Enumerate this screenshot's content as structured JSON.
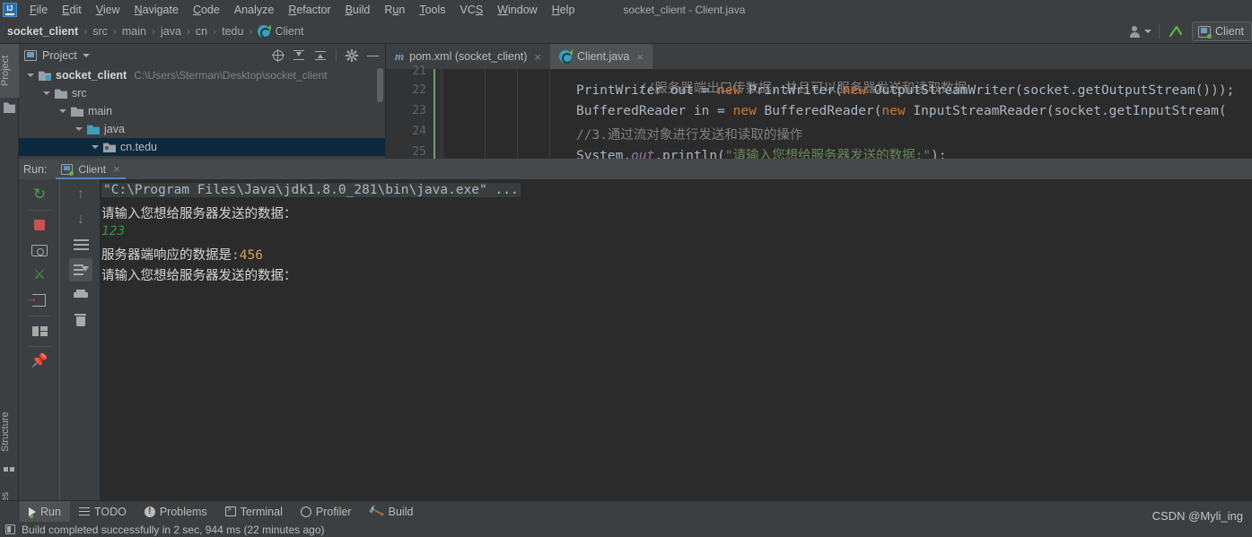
{
  "window": {
    "title": "socket_client - Client.java"
  },
  "menubar": {
    "logo": "intellij-idea-logo",
    "items": [
      {
        "label": "File",
        "mnemonic": "F"
      },
      {
        "label": "Edit",
        "mnemonic": "E"
      },
      {
        "label": "View",
        "mnemonic": "V"
      },
      {
        "label": "Navigate",
        "mnemonic": "N"
      },
      {
        "label": "Code",
        "mnemonic": "C"
      },
      {
        "label": "Analyze",
        "mnemonic": ""
      },
      {
        "label": "Refactor",
        "mnemonic": "R"
      },
      {
        "label": "Build",
        "mnemonic": "B"
      },
      {
        "label": "Run",
        "mnemonic": "R"
      },
      {
        "label": "Tools",
        "mnemonic": "T"
      },
      {
        "label": "VCS",
        "mnemonic": "S"
      },
      {
        "label": "Window",
        "mnemonic": "W"
      },
      {
        "label": "Help",
        "mnemonic": "H"
      }
    ]
  },
  "navbar": {
    "breadcrumbs": [
      "socket_client",
      "src",
      "main",
      "java",
      "cn",
      "tedu",
      "Client"
    ],
    "separator": "›",
    "right": {
      "account_icon": "user-avatar-icon",
      "caret_icon": "chevron-down-icon",
      "vcs_update_icon": "vcs-update-arrow-icon",
      "run_config_name": "Client",
      "run_config_icon": "run-configuration-icon"
    }
  },
  "left_strip": {
    "tabs": [
      {
        "label": "Project",
        "icon": "folder-icon",
        "active": true
      },
      {
        "label": "Structure",
        "icon": "structure-icon",
        "active": false
      },
      {
        "label": "Favorites",
        "icon": "star-icon",
        "active": false
      }
    ],
    "bottom_icon": "layout-icon"
  },
  "project": {
    "title": "Project",
    "title_icon": "project-icon",
    "dropdown_icon": "chevron-down-icon",
    "toolbar": [
      {
        "name": "locate-icon",
        "title": "Select Opened File"
      },
      {
        "name": "expand-all-icon",
        "title": "Expand All"
      },
      {
        "name": "collapse-all-icon",
        "title": "Collapse All"
      },
      {
        "name": "gear-icon",
        "title": "Settings"
      },
      {
        "name": "minimize-icon",
        "title": "Hide"
      }
    ],
    "tree": [
      {
        "label": "socket_client",
        "path": "C:\\Users\\Sterman\\Desktop\\socket_client",
        "depth": 0,
        "icon": "module-icon",
        "bold": true,
        "selected": false
      },
      {
        "label": "src",
        "path": "",
        "depth": 1,
        "icon": "folder-grey-icon",
        "bold": false,
        "selected": false
      },
      {
        "label": "main",
        "path": "",
        "depth": 2,
        "icon": "folder-grey-icon",
        "bold": false,
        "selected": false
      },
      {
        "label": "java",
        "path": "",
        "depth": 3,
        "icon": "folder-blue-icon",
        "bold": false,
        "selected": false
      },
      {
        "label": "cn.tedu",
        "path": "",
        "depth": 4,
        "icon": "package-icon",
        "bold": false,
        "selected": true
      }
    ]
  },
  "editor": {
    "tabs": [
      {
        "label": "pom.xml (socket_client)",
        "icon": "maven-icon",
        "active": false,
        "close": "×"
      },
      {
        "label": "Client.java",
        "icon": "java-class-icon",
        "active": true,
        "close": "×"
      }
    ],
    "line_numbers": [
      "21",
      "22",
      "23",
      "24",
      "25"
    ],
    "lines": [
      {
        "num": "21",
        "tokens": [
          {
            "t": "//服务器端出口传数据，并且可以服务器发送和读取数据",
            "c": "cmt"
          }
        ]
      },
      {
        "num": "22",
        "tokens": [
          {
            "t": "PrintWriter out = ",
            "c": "pln"
          },
          {
            "t": "new",
            "c": "kw"
          },
          {
            "t": " PrintWriter(",
            "c": "pln"
          },
          {
            "t": "new",
            "c": "kw"
          },
          {
            "t": " OutputStreamWriter(socket.getOutputStream()))",
            "c": "pln"
          },
          {
            "t": ";",
            "c": "pln"
          }
        ]
      },
      {
        "num": "23",
        "tokens": [
          {
            "t": "BufferedReader in = ",
            "c": "pln"
          },
          {
            "t": "new",
            "c": "kw"
          },
          {
            "t": " BufferedReader(",
            "c": "pln"
          },
          {
            "t": "new",
            "c": "kw"
          },
          {
            "t": " InputStreamReader(socket.getInputStream(",
            "c": "pln"
          }
        ]
      },
      {
        "num": "24",
        "tokens": [
          {
            "t": "//3.通过流对象进行发送和读取的操作",
            "c": "cmt"
          }
        ]
      },
      {
        "num": "25",
        "tokens": [
          {
            "t": "System.",
            "c": "pln"
          },
          {
            "t": "out",
            "c": "fld"
          },
          {
            "t": ".println(",
            "c": "pln"
          },
          {
            "t": "\"请输入您想给服务器发送的数据:\"",
            "c": "str"
          },
          {
            "t": ");",
            "c": "pln"
          }
        ]
      }
    ]
  },
  "run_window": {
    "label": "Run:",
    "tab": {
      "label": "Client",
      "icon": "run-configuration-icon",
      "close": "×"
    },
    "sidebar_left": [
      {
        "name": "rerun-icon",
        "title": "Rerun"
      },
      {
        "name": "stop-icon",
        "title": "Stop"
      },
      {
        "name": "camera-icon",
        "title": "Dump Threads"
      },
      {
        "name": "thread-dump-icon",
        "title": "Thread Dump"
      },
      {
        "name": "exit-icon",
        "title": "Exit"
      },
      {
        "name": "layout-icon",
        "title": "Layout Settings"
      },
      {
        "name": "pin-icon",
        "title": "Pin Tab"
      }
    ],
    "sidebar_right": [
      {
        "name": "arrow-up-icon",
        "title": "Up the Stack Trace"
      },
      {
        "name": "arrow-down-icon",
        "title": "Down the Stack Trace"
      },
      {
        "name": "soft-wrap-icon",
        "title": "Soft-Wrap"
      },
      {
        "name": "scroll-to-end-icon",
        "title": "Scroll to End",
        "active": true
      },
      {
        "name": "print-icon",
        "title": "Print"
      },
      {
        "name": "trash-icon",
        "title": "Clear All"
      }
    ],
    "console": [
      {
        "type": "command",
        "text": "\"C:\\Program Files\\Java\\jdk1.8.0_281\\bin\\java.exe\" ..."
      },
      {
        "type": "out",
        "text": "请输入您想给服务器发送的数据："
      },
      {
        "type": "input",
        "text": "123"
      },
      {
        "type": "out_mixed",
        "text": "服务器端响应的数据是",
        "suffix": ":456"
      },
      {
        "type": "out",
        "text": "请输入您想给服务器发送的数据："
      }
    ]
  },
  "bottom_tabs": [
    {
      "label": "Run",
      "icon": "run-triangle-icon",
      "active": true
    },
    {
      "label": "TODO",
      "icon": "list-icon",
      "active": false
    },
    {
      "label": "Problems",
      "icon": "info-icon",
      "active": false
    },
    {
      "label": "Terminal",
      "icon": "terminal-icon",
      "active": false
    },
    {
      "label": "Profiler",
      "icon": "profiler-icon",
      "active": false
    },
    {
      "label": "Build",
      "icon": "build-hammer-icon",
      "active": false
    }
  ],
  "statusbar": {
    "icon": "message-icon",
    "text": "Build completed successfully in 2 sec, 944 ms (22 minutes ago)"
  },
  "watermark": "CSDN @Myli_ing",
  "colors": {
    "chrome": "#3c3f41",
    "editor_bg": "#2b2b2b",
    "selection": "#0d293e",
    "accent": "#4a88c7",
    "green": "#499c54",
    "red": "#c75450",
    "keyword": "#cc7832",
    "string": "#6a8759"
  }
}
